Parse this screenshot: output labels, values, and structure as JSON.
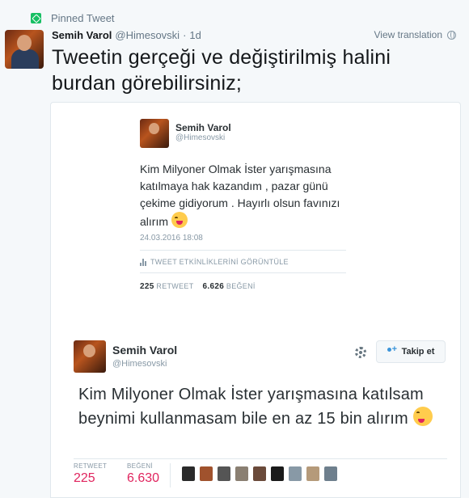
{
  "pinned_label": "Pinned Tweet",
  "user": {
    "name": "Semih Varol",
    "handle": "@Himesovski",
    "time": "1d"
  },
  "separator": "·",
  "view_translation": "View translation",
  "tweet_text": "Tweetin gerçeği ve değiştirilmiş halini burdan görebilirsiniz;",
  "card1": {
    "name": "Semih Varol",
    "handle": "@Himesovski",
    "text": "Kim Milyoner Olmak İster yarışmasına katılmaya hak kazandım , pazar günü çekime gidiyorum . Hayırlı olsun favınızı alırım",
    "date": "24.03.2016 18:08",
    "stats_link": "TWEET ETKİNLİKLERİNİ GÖRÜNTÜLE",
    "retweets": "225",
    "retweet_label": "RETWEET",
    "likes": "6.626",
    "like_label": "BEĞENİ"
  },
  "card2": {
    "name": "Semih Varol",
    "handle": "@Himesovski",
    "follow_label": "Takip et",
    "text": "Kim Milyoner Olmak İster yarışmasına katılsam beynimi kullanmasam bile en az 15 bin alırım",
    "retweet_label": "RETWEET",
    "retweets": "225",
    "like_label": "BEĞENİ",
    "likes": "6.630"
  },
  "colors": {
    "pin": "#17bf63",
    "like_count": "#e0245e",
    "follow_icon": "#3b94d9"
  },
  "liker_colors": [
    "#2a2a2a",
    "#a0522d",
    "#555555",
    "#8a7f72",
    "#6a4a3a",
    "#1a1a1a",
    "#8899a6",
    "#b59a7a",
    "#6e7f8d"
  ]
}
